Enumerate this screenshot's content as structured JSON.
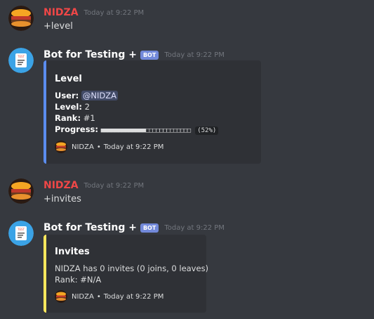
{
  "colors": {
    "background": "#36393f",
    "embed_bg": "#2f3136",
    "level_accent": "#5b8def",
    "invites_accent": "#fee75c",
    "user_name": "#f04747",
    "bot_tag": "#7289da"
  },
  "messages": [
    {
      "author": "NIDZA",
      "timestamp": "Today at 9:22 PM",
      "text": "+level",
      "avatar_icon": "burger-avatar-icon"
    },
    {
      "author": "Bot for Testing +",
      "bot_tag": "BOT",
      "timestamp": "Today at 9:22 PM",
      "avatar_icon": "test-doc-avatar-icon",
      "embed": {
        "title": "Level",
        "user_label": "User:",
        "user_value": "@NIDZA",
        "level_label": "Level:",
        "level_value": "2",
        "rank_label": "Rank:",
        "rank_value": "#1",
        "progress_label": "Progress:",
        "progress_bar": "■■■■■■■■■■■■■□□□□□□□□□□□□□",
        "progress_percent": "(52%)",
        "progress_fraction": 0.52,
        "footer_name": "NIDZA",
        "footer_sep": "•",
        "footer_time": "Today at 9:22 PM"
      }
    },
    {
      "author": "NIDZA",
      "timestamp": "Today at 9:22 PM",
      "text": "+invites",
      "avatar_icon": "burger-avatar-icon"
    },
    {
      "author": "Bot for Testing +",
      "bot_tag": "BOT",
      "timestamp": "Today at 9:22 PM",
      "avatar_icon": "test-doc-avatar-icon",
      "embed": {
        "title": "Invites",
        "line1": "NIDZA has 0 invites (0 joins, 0 leaves)",
        "line2": "Rank: #N/A",
        "footer_name": "NIDZA",
        "footer_sep": "•",
        "footer_time": "Today at 9:22 PM"
      }
    }
  ]
}
